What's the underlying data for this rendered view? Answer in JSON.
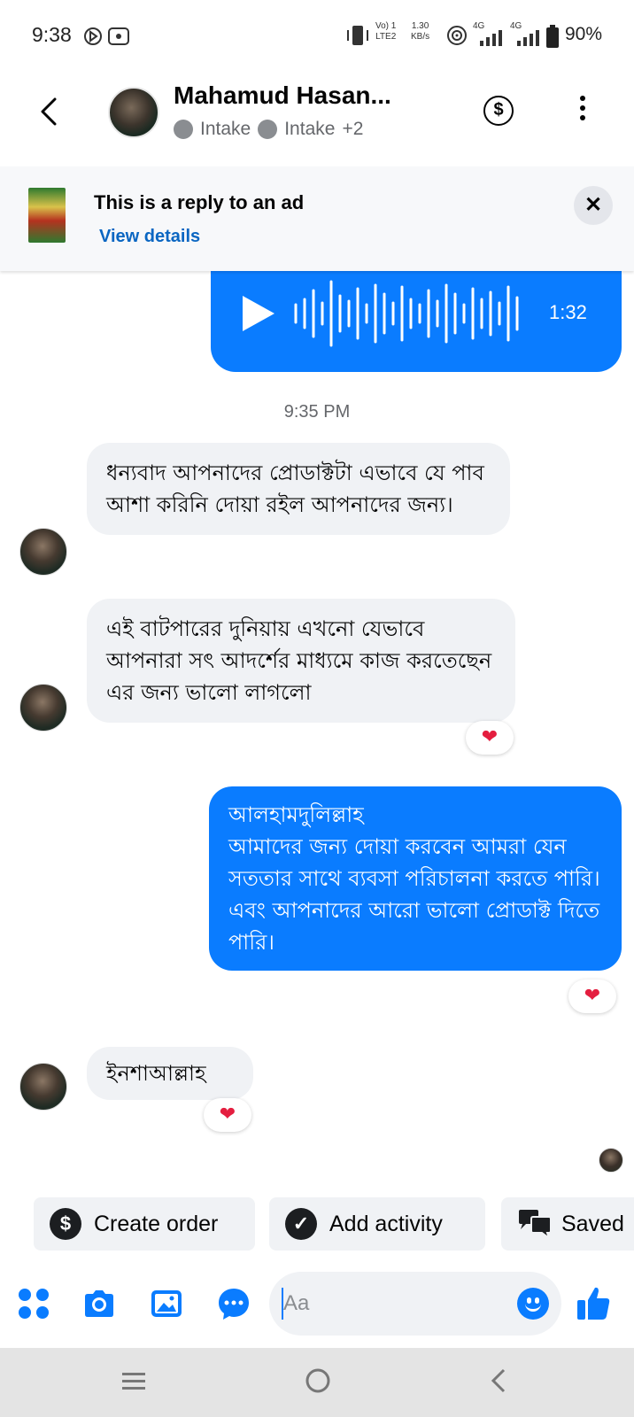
{
  "status_bar": {
    "time": "9:38",
    "volte": "Vo) 1",
    "lte": "LTE2",
    "speed_value": "1.30",
    "speed_unit": "KB/s",
    "net1": "4G",
    "net2": "4G",
    "battery": "90%"
  },
  "header": {
    "contact_name": "Mahamud Hasan...",
    "label1": "Intake",
    "label2": "Intake",
    "label_more": "+2"
  },
  "ad": {
    "title": "This is a reply to an ad",
    "link": "View details",
    "close": "✕"
  },
  "messages": {
    "voice_duration": "1:32",
    "timestamp": "9:35 PM",
    "msg1": "ধন্যবাদ আপনাদের প্রোডাক্টটা এভাবে যে পাব আশা করিনি দোয়া রইল আপনাদের জন্য।",
    "msg2": "এই বাটপারের দুনিয়ায় এখনো যেভাবে আপনারা সৎ আদর্শের মাধ্যমে কাজ করতেছেন এর জন্য ভালো লাগলো",
    "msg3_line1": "আলহামদুলিল্লাহ",
    "msg3_line2": "আমাদের জন্য দোয়া করবেন আমরা যেন সততার সাথে ব্যবসা পরিচালনা করতে পারি। এবং আপনাদের আরো ভালো প্রোডাক্ট দিতে পারি।",
    "msg4": "ইনশাআল্লাহ",
    "reaction": "❤"
  },
  "quick_actions": {
    "create_order": "Create order",
    "add_activity": "Add activity",
    "saved": "Saved"
  },
  "composer": {
    "placeholder": "Aa"
  },
  "colors": {
    "brand_blue": "#0a7cff",
    "incoming_bubble": "#f0f2f5",
    "reaction_red": "#e41e3f"
  },
  "icons": [
    "back-chevron-icon",
    "dollar-icon",
    "more-vertical-icon",
    "play-icon",
    "heart-icon",
    "apps-icon",
    "camera-icon",
    "gallery-icon",
    "chat-icon",
    "emoji-icon",
    "like-icon"
  ]
}
